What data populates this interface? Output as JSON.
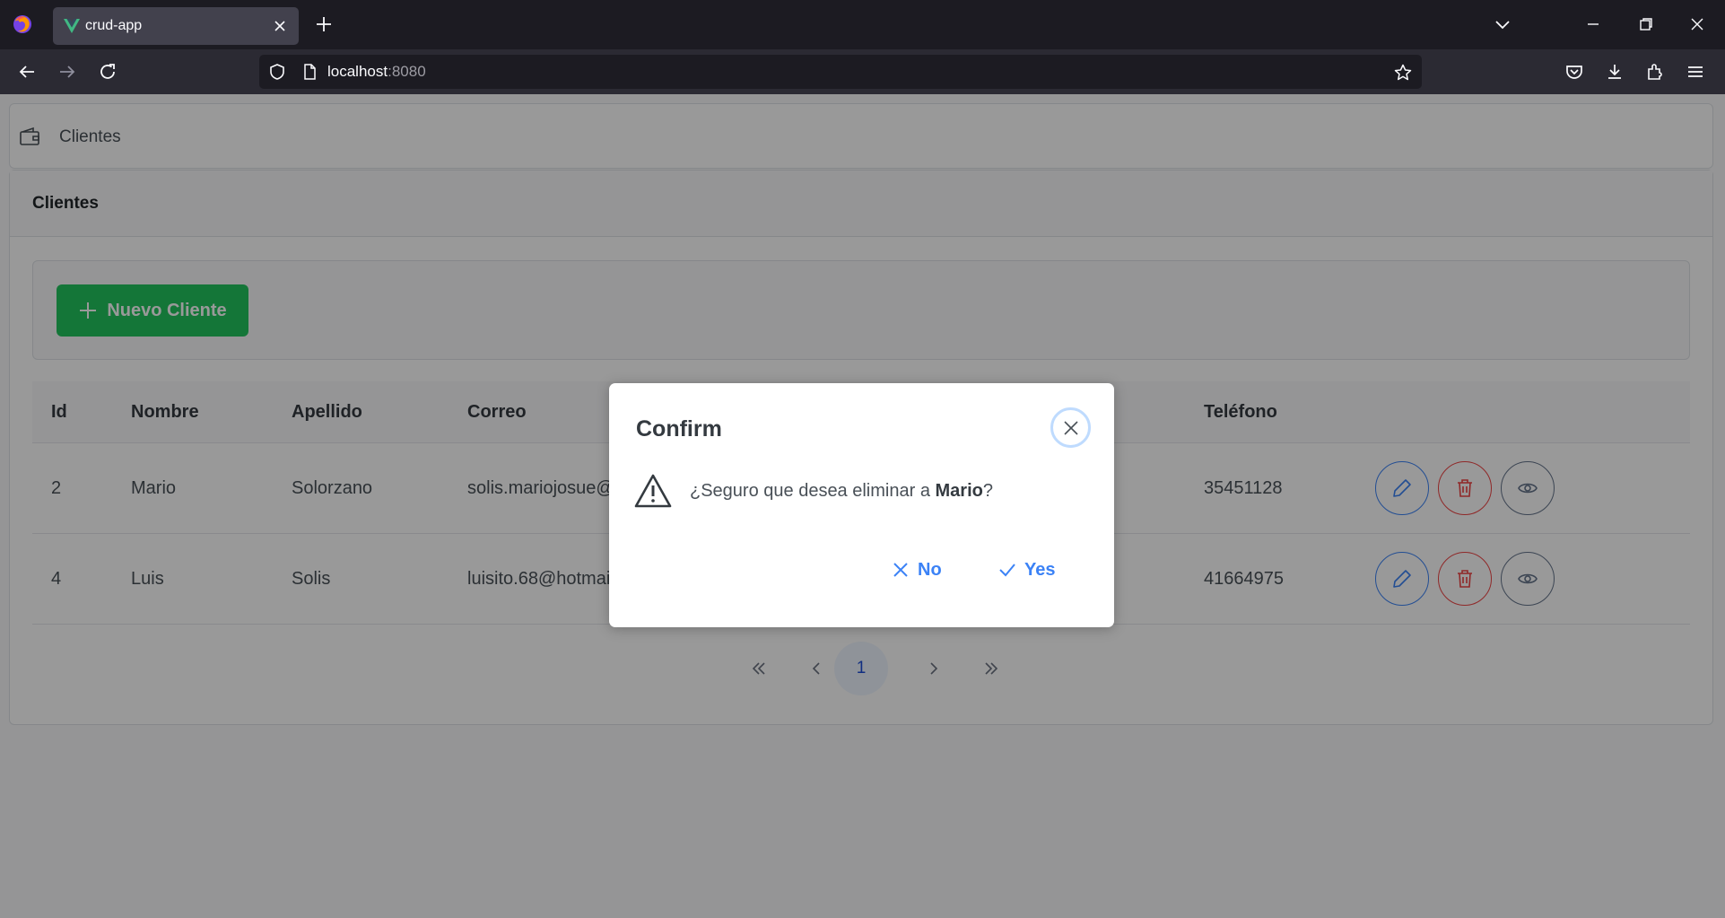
{
  "browser": {
    "tab_title": "crud-app",
    "url_host": "localhost",
    "url_port": ":8080"
  },
  "breadcrumb": {
    "label": "Clientes"
  },
  "card": {
    "title": "Clientes"
  },
  "toolbar": {
    "new_button_label": "Nuevo Cliente"
  },
  "table": {
    "columns": [
      "Id",
      "Nombre",
      "Apellido",
      "Correo",
      "Teléfono"
    ],
    "rows": [
      {
        "id": "2",
        "nombre": "Mario",
        "apellido": "Solorzano",
        "correo": "solis.mariojosue@",
        "telefono": "35451128"
      },
      {
        "id": "4",
        "nombre": "Luis",
        "apellido": "Solis",
        "correo": "luisito.68@hotmai",
        "telefono": "41664975"
      }
    ]
  },
  "paginator": {
    "current_page": "1"
  },
  "dialog": {
    "title": "Confirm",
    "message_prefix": "¿Seguro que desea eliminar a ",
    "message_name": "Mario",
    "message_suffix": "?",
    "no_label": "No",
    "yes_label": "Yes"
  },
  "colors": {
    "primary": "#3b82f6",
    "success": "#22c55e",
    "danger": "#ef4444",
    "secondary": "#64748b"
  }
}
